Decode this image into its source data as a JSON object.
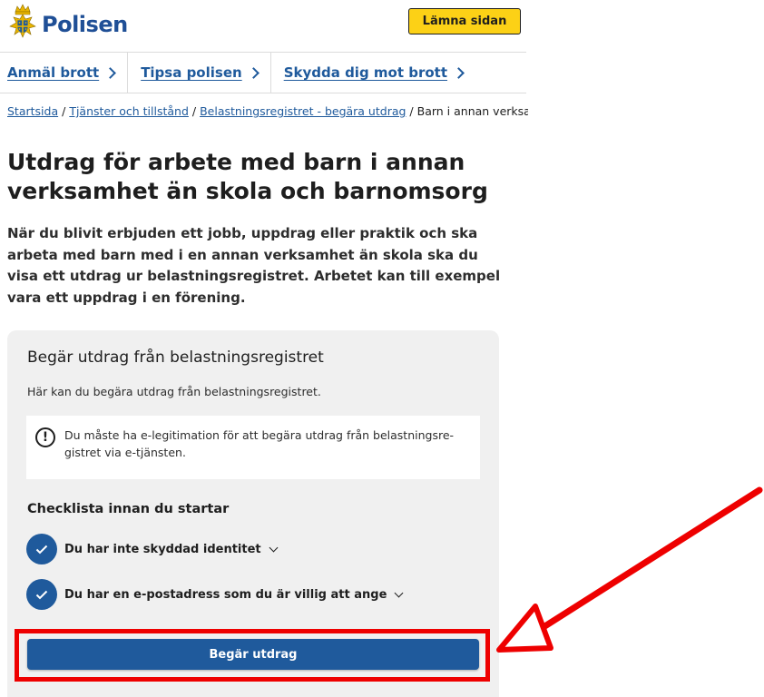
{
  "header": {
    "logo_text": "Polisen",
    "leave_button": "Lämna sidan"
  },
  "nav": {
    "items": [
      {
        "label": "Anmäl brott"
      },
      {
        "label": "Tipsa polisen"
      },
      {
        "label": "Skydda dig mot brott"
      }
    ]
  },
  "breadcrumb": {
    "items": [
      {
        "label": "Startsida"
      },
      {
        "label": "Tjänster och tillstånd"
      },
      {
        "label": "Belastningsregistret - begära utdrag"
      }
    ],
    "separator": "/",
    "current": "Barn i annan verksamhet"
  },
  "page": {
    "title": "Utdrag för arbete med barn i annan verksamhet än skola och barnomsorg",
    "lead": "När du blivit erbjuden ett jobb, uppdrag eller praktik och ska arbeta med barn med i en annan verksamhet än skola ska du visa ett utdrag ur belastningsregistret. Arbetet kan till exempel vara ett uppdrag i en förening."
  },
  "card": {
    "title": "Begär utdrag från belastningsregistret",
    "intro": "Här kan du begära utdrag från belastningsregistret.",
    "notice": "Du måste ha e-legitimation för att begära utdrag från belastningsre-gistret via e-tjänsten.",
    "notice_icon_text": "!",
    "checklist_title": "Checklista innan du startar",
    "checklist": [
      {
        "label": "Du har inte skyddad identitet"
      },
      {
        "label": "Du har en e-postadress som du är villig att ange"
      }
    ],
    "button": "Begär utdrag"
  },
  "colors": {
    "brand_blue": "#1f5a9c",
    "link_blue": "#1f5a9c",
    "leave_yellow": "#fcd116",
    "card_bg": "#f0f0f0",
    "annotation_red": "#ee0000"
  },
  "icons": {
    "logo": "police-emblem-icon",
    "nav_chevron": "chevron-right-icon",
    "notice": "exclamation-circle-icon",
    "check": "checkmark-icon",
    "expand": "chevron-down-icon"
  }
}
